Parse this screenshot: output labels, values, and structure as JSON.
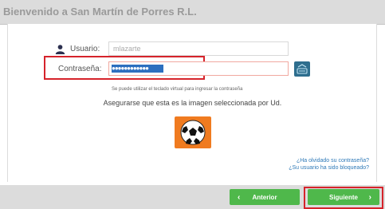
{
  "window": {
    "title": "Bienvenido a San Martín de Porres R.L."
  },
  "form": {
    "user_label": "Usuario:",
    "user_value": "mlazarte",
    "password_label": "Contraseña:",
    "password_mask": "●●●●●●●●●●●●",
    "keyboard_hint": "Se puede utilizar el teclado virtual para ingresar la contraseña",
    "verify_text": "Asegurarse que esta es la imagen seleccionada por Ud."
  },
  "links": {
    "forgot_password": "¿Ha olvidado su contraseña?",
    "user_blocked": "¿Su usuario ha sido bloqueado?"
  },
  "buttons": {
    "previous": "Anterior",
    "next": "Siguiente"
  },
  "icons": {
    "user": "user-icon",
    "keyboard": "virtual-keyboard-icon",
    "security_image": "soccer-ball-icon"
  },
  "colors": {
    "accent_green": "#4fb84b",
    "highlight_red": "#d6232b",
    "tile_orange": "#f07b20"
  }
}
